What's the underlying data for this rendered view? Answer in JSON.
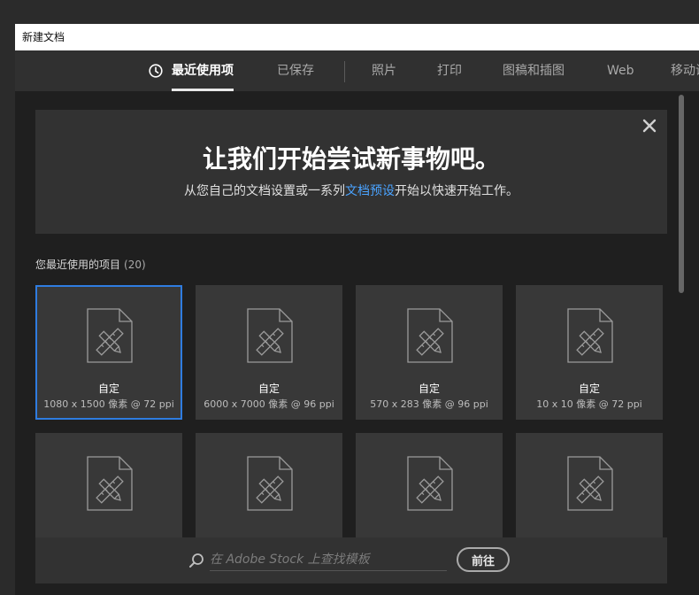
{
  "window": {
    "title": "新建文档"
  },
  "tabs": [
    {
      "id": "recent",
      "label": "最近使用项",
      "icon": "clock-icon",
      "active": true
    },
    {
      "id": "saved",
      "label": "已保存",
      "active": false
    },
    {
      "id": "photo",
      "label": "照片",
      "active": false
    },
    {
      "id": "print",
      "label": "打印",
      "active": false
    },
    {
      "id": "art",
      "label": "图稿和插图",
      "active": false
    },
    {
      "id": "web",
      "label": "Web",
      "active": false
    },
    {
      "id": "mobile",
      "label": "移动设备",
      "active": false
    }
  ],
  "welcome": {
    "headline": "让我们开始尝试新事物吧。",
    "sub_before": "从您自己的文档设置或一系列",
    "sub_link": "文档预设",
    "sub_after": "开始以快速开始工作。",
    "close_icon": "close-icon"
  },
  "recent": {
    "label": "您最近使用的项目",
    "count": "(20)"
  },
  "presets": [
    {
      "name": "自定",
      "dims": "1080 x 1500 像素 @ 72 ppi",
      "selected": true
    },
    {
      "name": "自定",
      "dims": "6000 x 7000 像素 @ 96 ppi",
      "selected": false
    },
    {
      "name": "自定",
      "dims": "570 x 283 像素 @ 96 ppi",
      "selected": false
    },
    {
      "name": "自定",
      "dims": "10 x 10 像素 @ 72 ppi",
      "selected": false
    },
    {
      "name": "",
      "dims": "",
      "selected": false
    },
    {
      "name": "",
      "dims": "",
      "selected": false
    },
    {
      "name": "",
      "dims": "",
      "selected": false
    },
    {
      "name": "",
      "dims": "",
      "selected": false
    }
  ],
  "stock": {
    "placeholder": "在 Adobe Stock 上查找模板",
    "search_icon": "search-icon",
    "go_label": "前往"
  },
  "colors": {
    "accent": "#2f7ce0",
    "link": "#4aa3ff",
    "panel": "#323232",
    "card": "#383838",
    "background": "#1f1f1f"
  }
}
